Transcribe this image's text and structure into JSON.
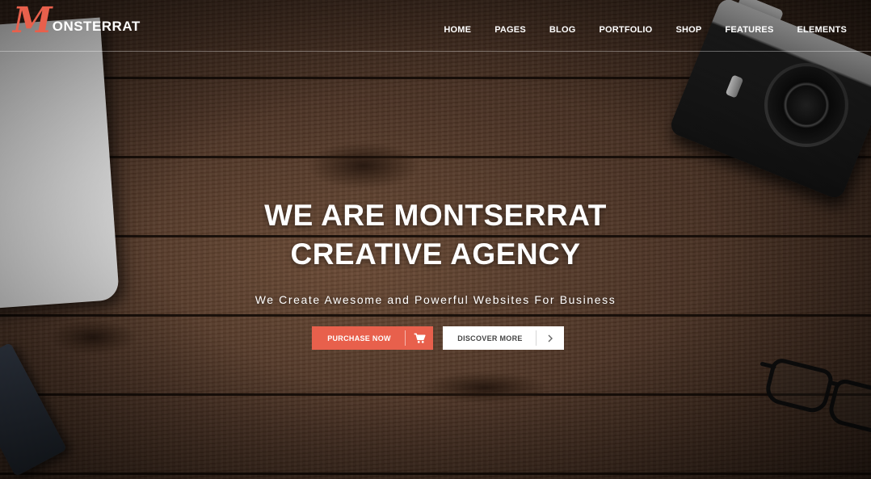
{
  "header": {
    "logo_initial": "M",
    "logo_rest": "ONSTERRAT",
    "nav": [
      {
        "label": "HOME"
      },
      {
        "label": "PAGES"
      },
      {
        "label": "BLOG"
      },
      {
        "label": "PORTFOLIO"
      },
      {
        "label": "SHOP"
      },
      {
        "label": "FEATURES"
      },
      {
        "label": "ELEMENTS"
      }
    ]
  },
  "hero": {
    "headline_line1": "WE ARE MONTSERRAT",
    "headline_line2": "CREATIVE AGENCY",
    "subheadline": "We Create Awesome and Powerful Websites For Business",
    "purchase_button": {
      "label": "PURCHASE NOW",
      "icon": "cart-icon"
    },
    "discover_button": {
      "label": "DISCOVER MORE",
      "icon": "chevron-right-icon"
    }
  },
  "colors": {
    "accent": "#e8604c",
    "text": "#ffffff",
    "button_light": "#ffffff"
  }
}
